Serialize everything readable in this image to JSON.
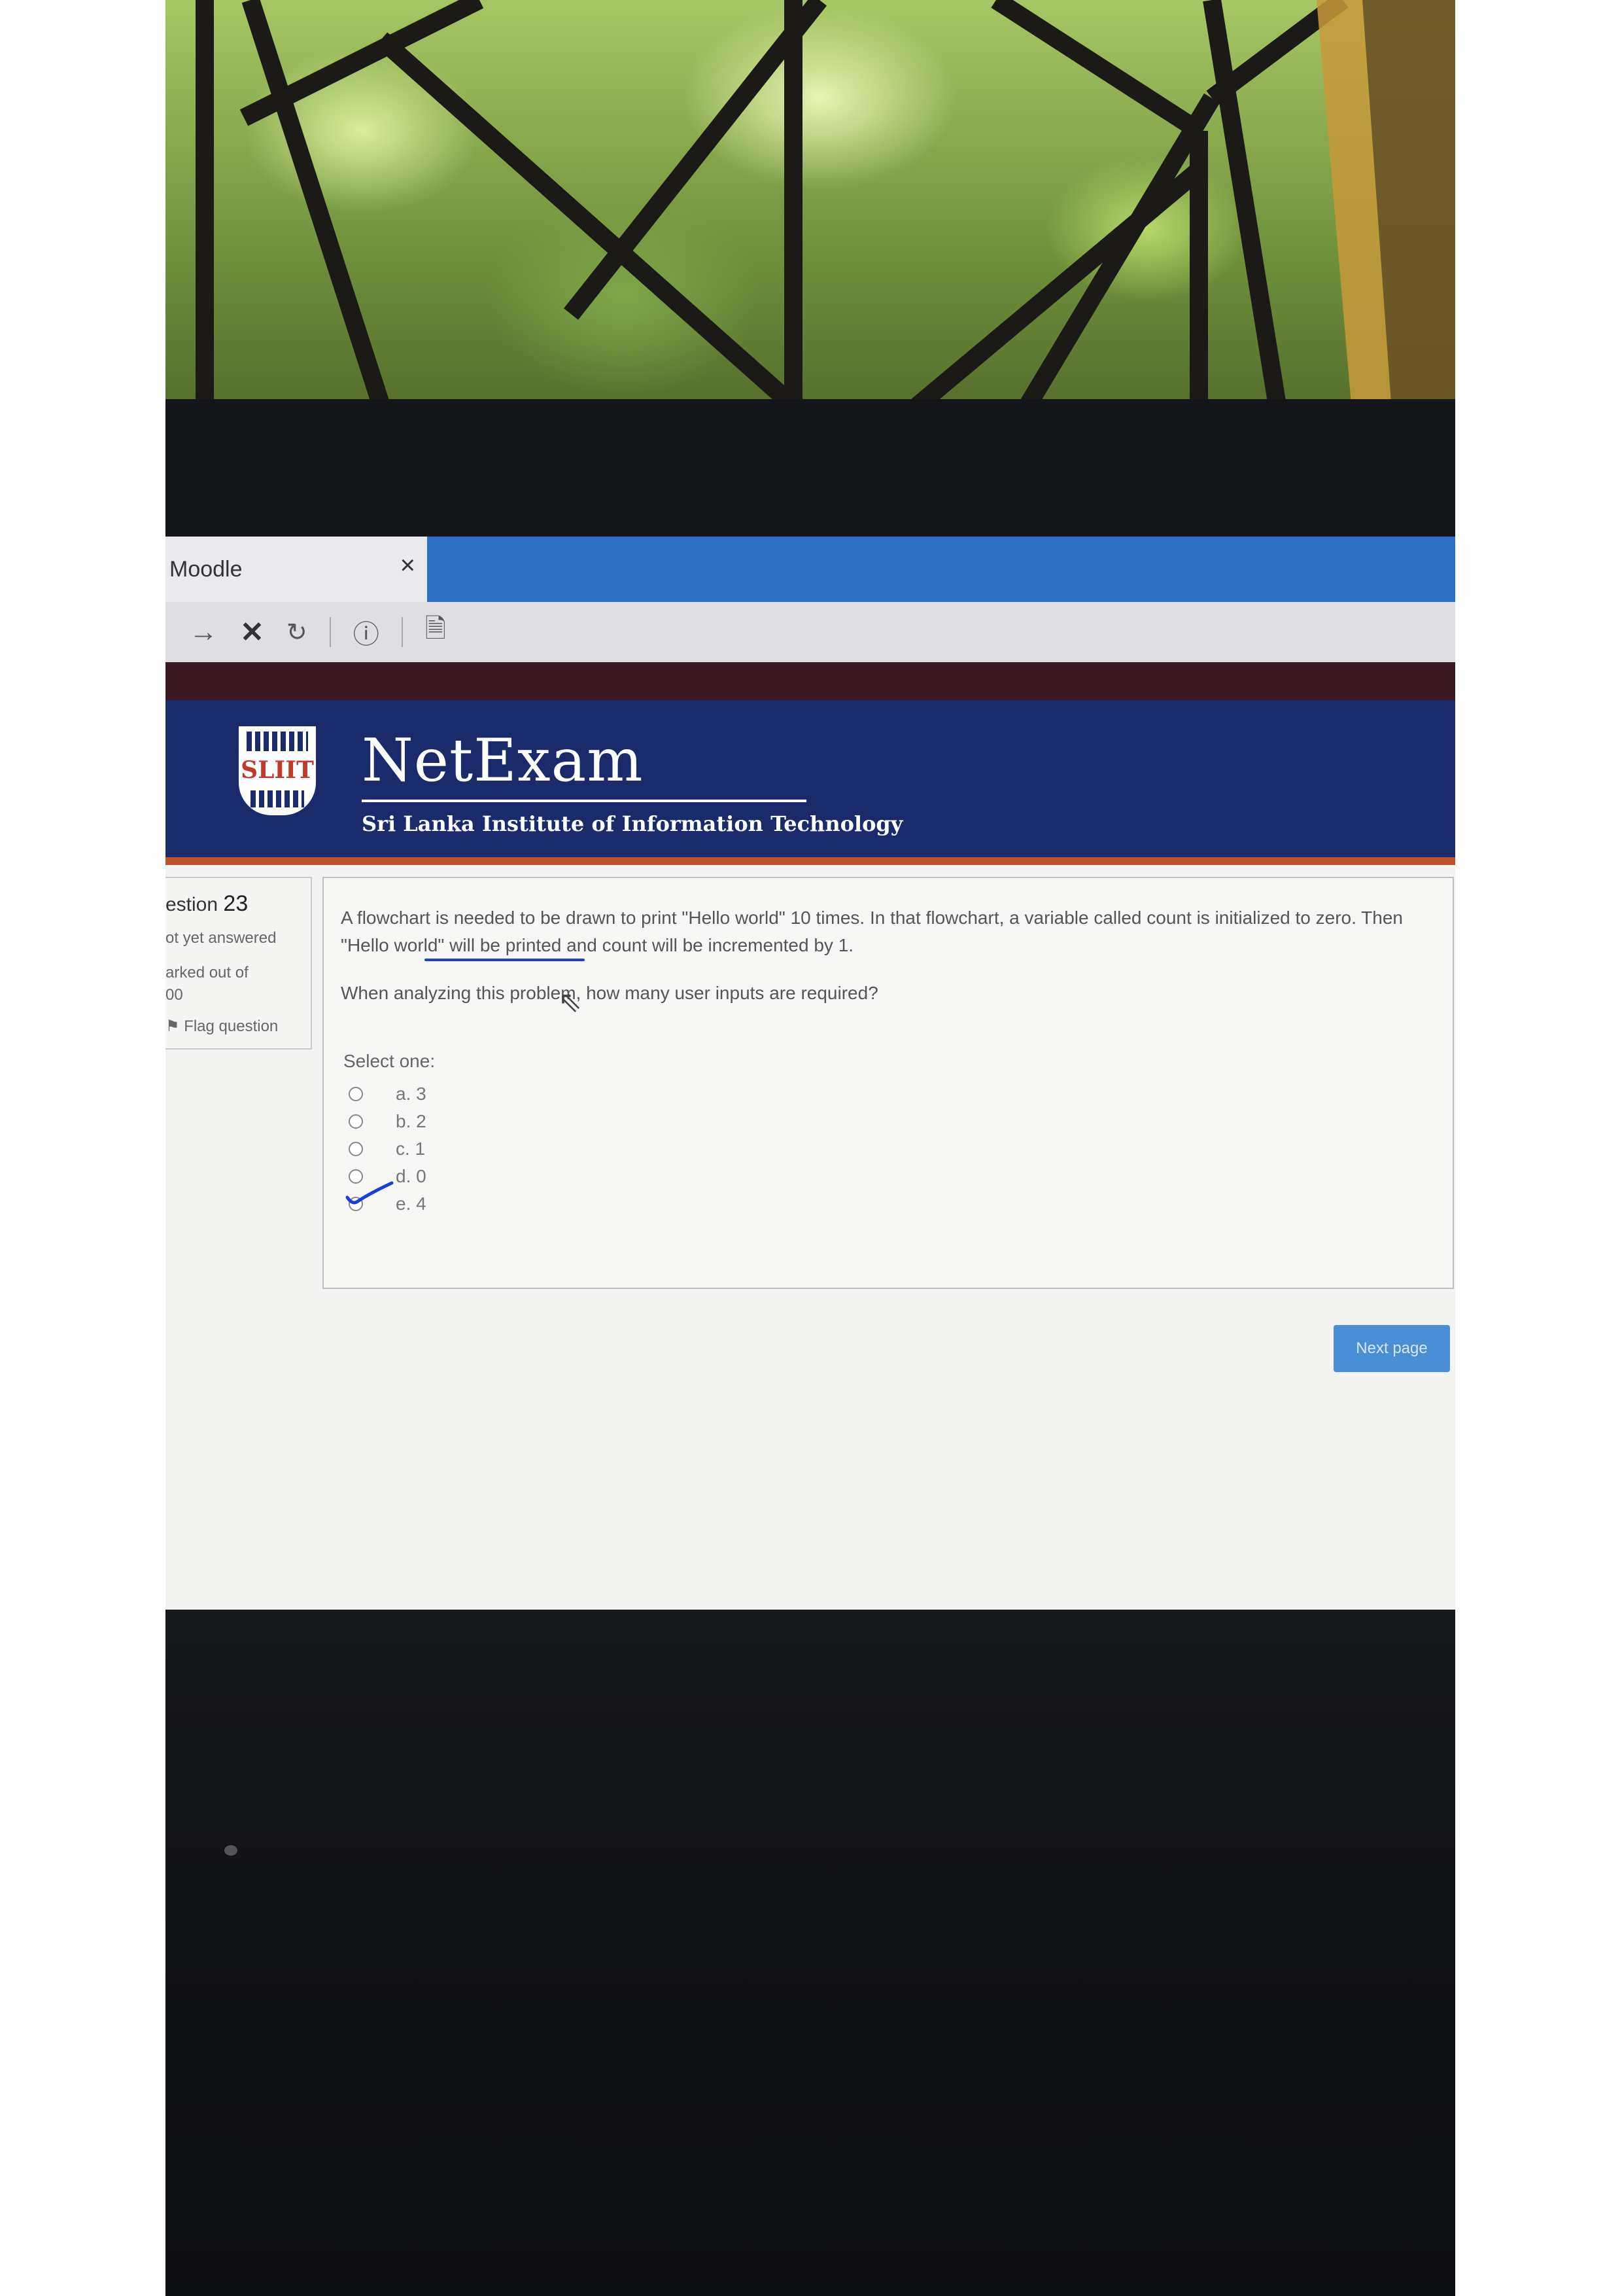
{
  "browser": {
    "tab_title": "Moodle",
    "tab_close_icon": "×",
    "toolbar_icons": [
      "forward-icon",
      "stop-icon",
      "reload-icon",
      "info-icon",
      "page-icon"
    ]
  },
  "header": {
    "logo_text": "SLIIT",
    "brand_name": "NetExam",
    "institute": "Sri Lanka Institute of Information Technology"
  },
  "question_nav": {
    "label_prefix": "estion",
    "number": "23",
    "state": "ot yet answered",
    "marked_prefix": "arked out of",
    "marked_value": "00",
    "flag_label": "Flag question"
  },
  "question": {
    "text": "A flowchart is needed to be drawn to print \"Hello world\" 10 times. In that flowchart, a variable called count is initialized to zero. Then \"Hello world\" will be printed and count will be incremented by 1.",
    "prompt": "When analyzing this problem, how many user inputs are required?",
    "select_label": "Select one:",
    "options": [
      {
        "label": "a. 3"
      },
      {
        "label": "b. 2"
      },
      {
        "label": "c. 1"
      },
      {
        "label": "d. 0"
      },
      {
        "label": "e. 4"
      }
    ],
    "annotated_option": "d. 0"
  },
  "navigation": {
    "next_label": "Next page"
  },
  "colors": {
    "header_bg": "#1b2a6b",
    "header_accent": "#c0532b",
    "tab_strip": "#2c6fc4",
    "next_button": "#4a8fd6",
    "pen_annotation": "#1a3fd6"
  }
}
